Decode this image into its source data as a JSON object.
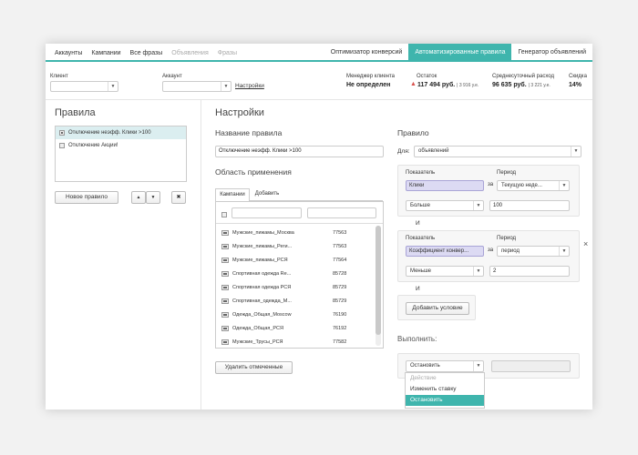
{
  "nav": {
    "left": [
      "Аккаунты",
      "Кампании",
      "Все фразы",
      "Объявления",
      "Фразы"
    ],
    "right": [
      "Оптимизатор конверсий",
      "Автоматизированные правила",
      "Генератор объявлений"
    ]
  },
  "filters": {
    "client_label": "Клиент",
    "account_label": "Аккаунт",
    "settings_link": "Настройки",
    "manager_title": "Менеджер клиента",
    "manager_value": "Не определен",
    "balance_title": "Остаток",
    "balance_value": "117 494 руб.",
    "balance_sub": "| 3 916 у.е.",
    "avg_title": "Среднесуточный расход",
    "avg_value": "96 635 руб.",
    "avg_sub": "| 3 221 у.е.",
    "discount_title": "Скидка",
    "discount_value": "14%"
  },
  "rules": {
    "title": "Правила",
    "items": [
      "Отключение неэфф. Клики >100",
      "Отключение Акции!"
    ],
    "new_button": "Новое правило",
    "up_icon": "▲",
    "down_icon": "▼",
    "delete_icon": "✖"
  },
  "settings": {
    "title": "Настройки",
    "rule_name_label": "Название правила",
    "rule_name_value": "Отключение неэфф. Клики >100",
    "scope_title": "Область применения",
    "tab_campaigns": "Кампании",
    "tab_add": "Добавить",
    "campaigns": [
      {
        "name": "Мужские_пижамы_Москва",
        "id": "77563"
      },
      {
        "name": "Мужские_пижамы_Реги...",
        "id": "77563"
      },
      {
        "name": "Мужские_пижамы_РСЯ",
        "id": "77564"
      },
      {
        "name": "Спортивная одежда Re...",
        "id": "85728"
      },
      {
        "name": "Спортивная одежда РСЯ",
        "id": "85729"
      },
      {
        "name": "Спортивная_одежда_М...",
        "id": "85729"
      },
      {
        "name": "Одежда_Общая_Moscow",
        "id": "76190"
      },
      {
        "name": "Одежда_Общая_РСЯ",
        "id": "76192"
      },
      {
        "name": "Мужские_Трусы_РСЯ",
        "id": "77582"
      }
    ],
    "delete_selected": "Удалить отмеченные"
  },
  "rule": {
    "title": "Правило",
    "for_label": "Для:",
    "for_value": "объявлений",
    "cond1": {
      "metric_label": "Показатель",
      "period_label": "Период",
      "metric": "Клики",
      "for_word": "за",
      "period": "Текущую неде...",
      "op": "Больше",
      "value": "100"
    },
    "and1": "И",
    "cond2": {
      "metric_label": "Показатель",
      "period_label": "Период",
      "metric": "Коэффициент конвер...",
      "for_word": "за",
      "period": "период",
      "op": "Меньше",
      "value": "2",
      "close": "×"
    },
    "and2": "И",
    "add_condition": "Добавить условие",
    "execute_label": "Выполнить:",
    "execute_value": "Остановить",
    "menu": [
      "Действие",
      "Изменить ставку",
      "Остановить"
    ]
  },
  "colors": {
    "accent": "#3fb5ad",
    "warning": "#d9534f",
    "tag_bg": "#dcdaf3"
  }
}
